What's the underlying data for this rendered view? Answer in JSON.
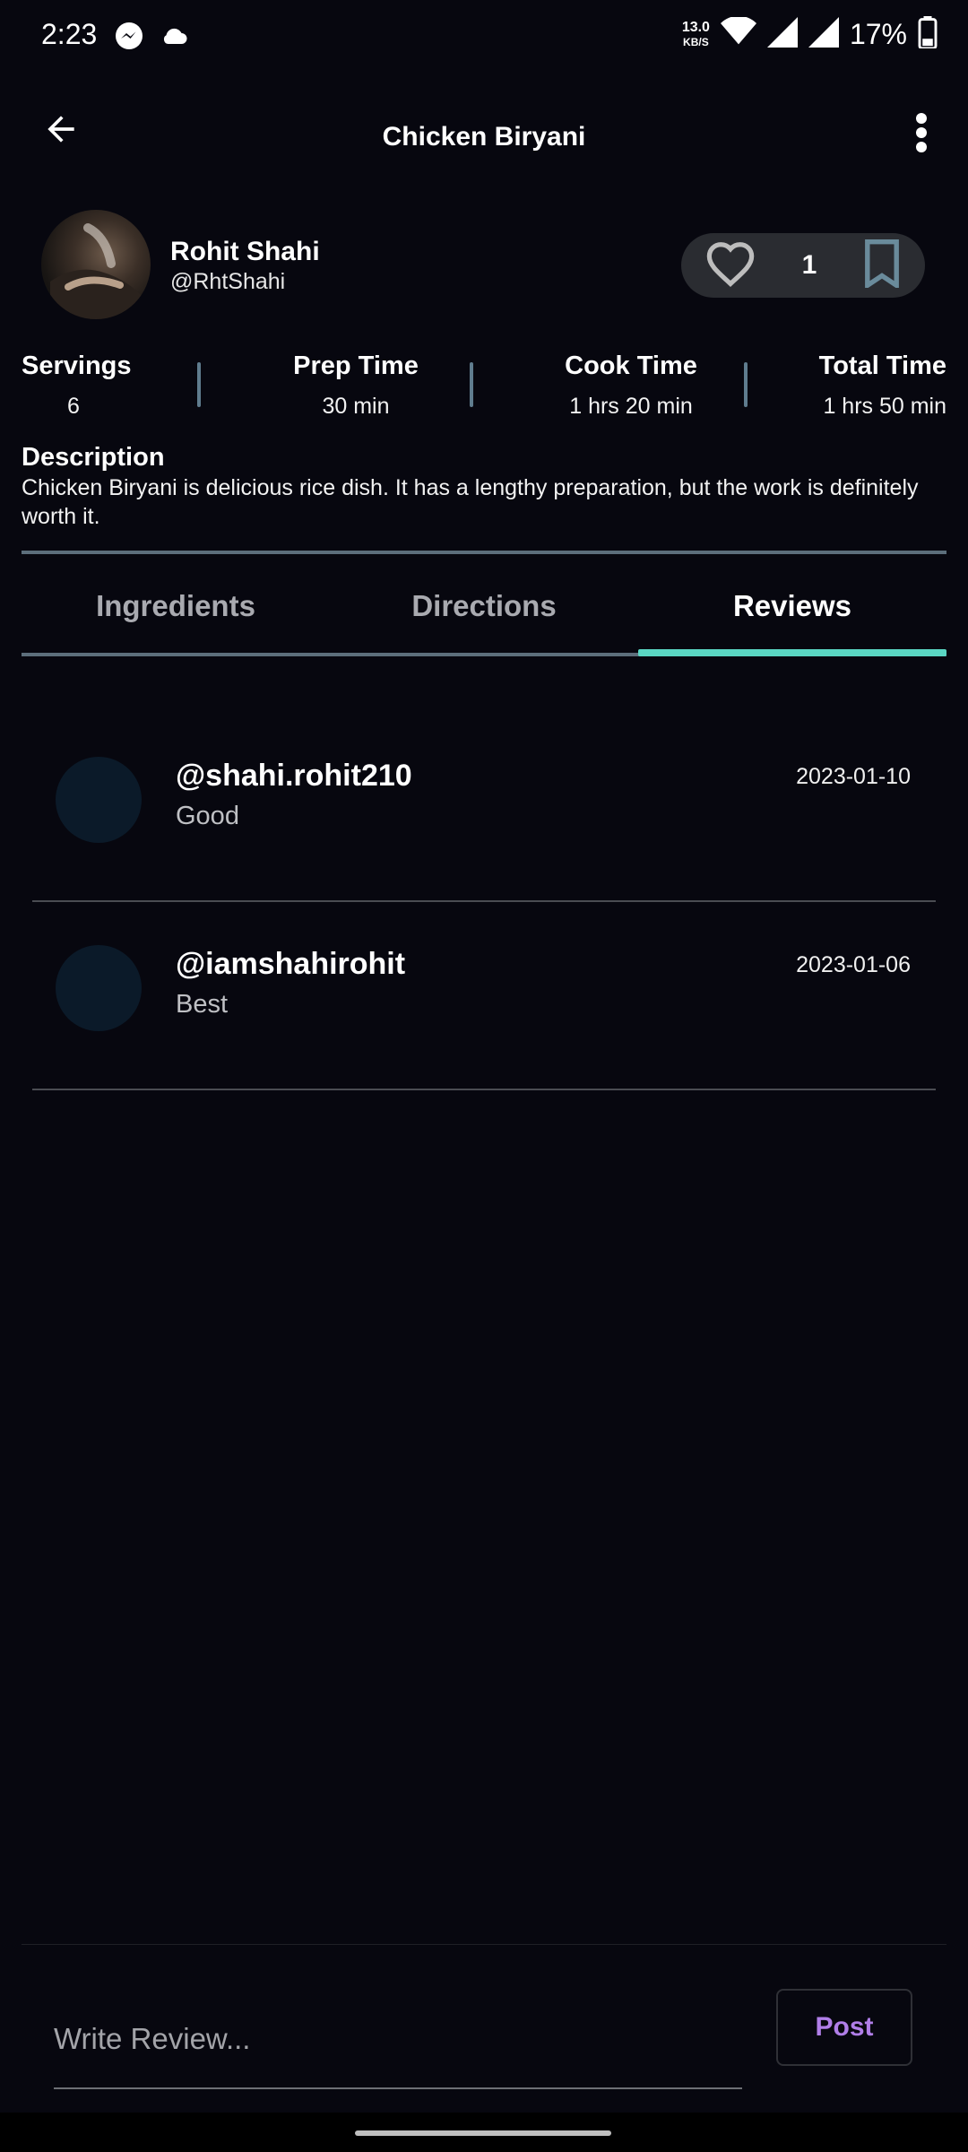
{
  "status_bar": {
    "time": "2:23",
    "net_speed_value": "13.0",
    "net_speed_unit": "KB/S",
    "battery": "17%"
  },
  "app_bar": {
    "title": "Chicken Biryani"
  },
  "author": {
    "name": "Rohit Shahi",
    "handle": "@RhtShahi"
  },
  "actions": {
    "like_count": "1"
  },
  "stats": [
    {
      "label": "Servings",
      "value": "6"
    },
    {
      "label": "Prep Time",
      "value": "30 min"
    },
    {
      "label": "Cook Time",
      "value": "1 hrs 20 min"
    },
    {
      "label": "Total Time",
      "value": "1 hrs 50 min"
    }
  ],
  "description": {
    "title": "Description",
    "text": "Chicken Biryani is delicious rice dish. It has a lengthy preparation, but the work is definitely worth it."
  },
  "tabs": [
    {
      "label": "Ingredients",
      "active": false
    },
    {
      "label": "Directions",
      "active": false
    },
    {
      "label": "Reviews",
      "active": true
    }
  ],
  "reviews": [
    {
      "user": "@shahi.rohit210",
      "text": "Good",
      "date": "2023-01-10"
    },
    {
      "user": "@iamshahirohit",
      "text": "Best",
      "date": "2023-01-06"
    }
  ],
  "composer": {
    "placeholder": "Write Review...",
    "post_label": "Post"
  },
  "colors": {
    "background": "#07070f",
    "accent_tab": "#5ad6c3",
    "post_text": "#b07ee8"
  }
}
